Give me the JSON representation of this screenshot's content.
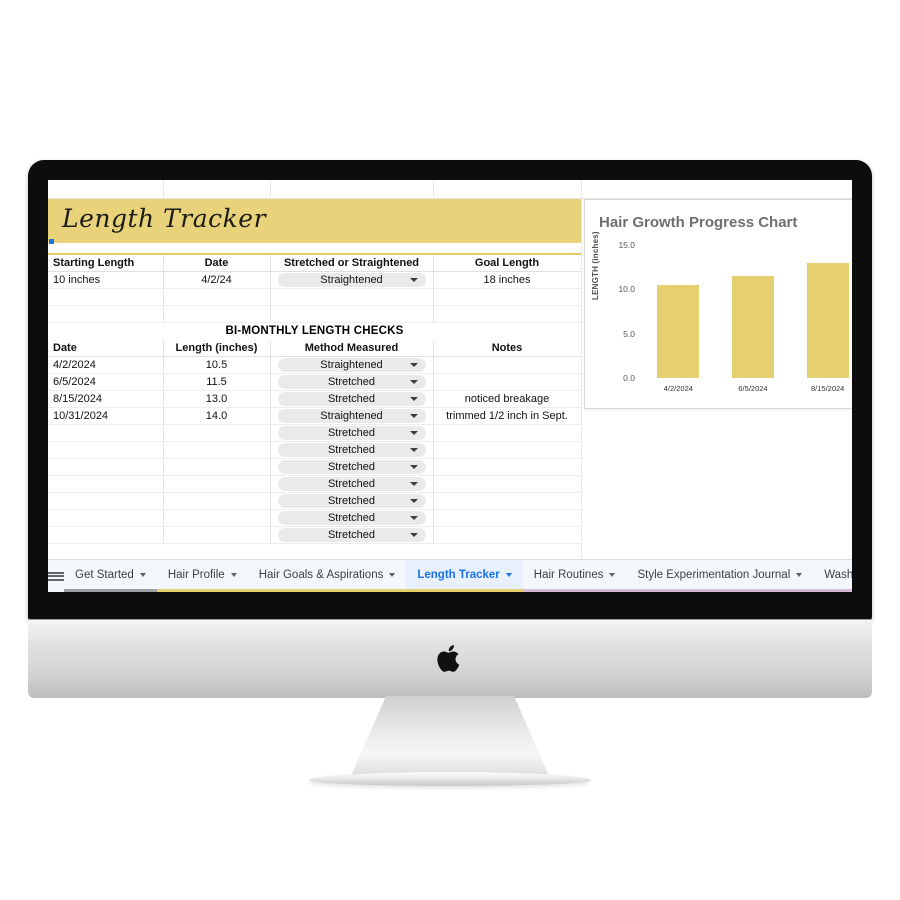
{
  "device": {
    "brand_logo": "apple-logo"
  },
  "sheet": {
    "banner_title": "Length Tracker",
    "banner_color": "#e8d27a",
    "summary": {
      "headers": [
        "Starting Length",
        "Date",
        "Stretched or Straightened",
        "Goal Length"
      ],
      "row": {
        "starting_length": "10 inches",
        "date": "4/2/24",
        "method": "Straightened",
        "goal_length": "18 inches"
      }
    },
    "section_title": "BI-MONTHLY LENGTH CHECKS",
    "checks": {
      "headers": [
        "Date",
        "Length (inches)",
        "Method Measured",
        "Notes"
      ],
      "rows": [
        {
          "date": "4/2/2024",
          "length": "10.5",
          "method": "Straightened",
          "notes": ""
        },
        {
          "date": "6/5/2024",
          "length": "11.5",
          "method": "Stretched",
          "notes": ""
        },
        {
          "date": "8/15/2024",
          "length": "13.0",
          "method": "Stretched",
          "notes": "noticed breakage"
        },
        {
          "date": "10/31/2024",
          "length": "14.0",
          "method": "Straightened",
          "notes": "trimmed 1/2 inch in Sept."
        },
        {
          "date": "",
          "length": "",
          "method": "Stretched",
          "notes": ""
        },
        {
          "date": "",
          "length": "",
          "method": "Stretched",
          "notes": ""
        },
        {
          "date": "",
          "length": "",
          "method": "Stretched",
          "notes": ""
        },
        {
          "date": "",
          "length": "",
          "method": "Stretched",
          "notes": ""
        },
        {
          "date": "",
          "length": "",
          "method": "Stretched",
          "notes": ""
        },
        {
          "date": "",
          "length": "",
          "method": "Stretched",
          "notes": ""
        },
        {
          "date": "",
          "length": "",
          "method": "Stretched",
          "notes": ""
        }
      ]
    }
  },
  "chart_data": {
    "type": "bar",
    "title": "Hair Growth Progress Chart",
    "categories": [
      "4/2/2024",
      "6/5/2024",
      "8/15/2024"
    ],
    "values": [
      10.5,
      11.5,
      13.0
    ],
    "xlabel": "",
    "ylabel": "LENGTH (inches)",
    "ylim": [
      0,
      15
    ],
    "yticks": [
      "0.0",
      "5.0",
      "10.0",
      "15.0"
    ],
    "grid": false,
    "legend": "none",
    "bar_color": "#e6cf6e",
    "title_color": "#6f6f6f"
  },
  "tabbar": {
    "menu_icon": "hamburger-icon",
    "tabs": [
      {
        "label": "Get Started",
        "active": false,
        "accent": "#9aa0a6"
      },
      {
        "label": "Hair Profile",
        "active": false,
        "accent": "#e6cf6e"
      },
      {
        "label": "Hair Goals & Aspirations",
        "active": false,
        "accent": "#e6cf6e"
      },
      {
        "label": "Length Tracker",
        "active": true,
        "accent": "#e6cf6e"
      },
      {
        "label": "Hair Routines",
        "active": false,
        "accent": "#d8b8d8"
      },
      {
        "label": "Style Experimentation Journal",
        "active": false,
        "accent": "#d8b8d8"
      },
      {
        "label": "Wash D",
        "active": false,
        "accent": "#d8b8d8"
      }
    ]
  }
}
